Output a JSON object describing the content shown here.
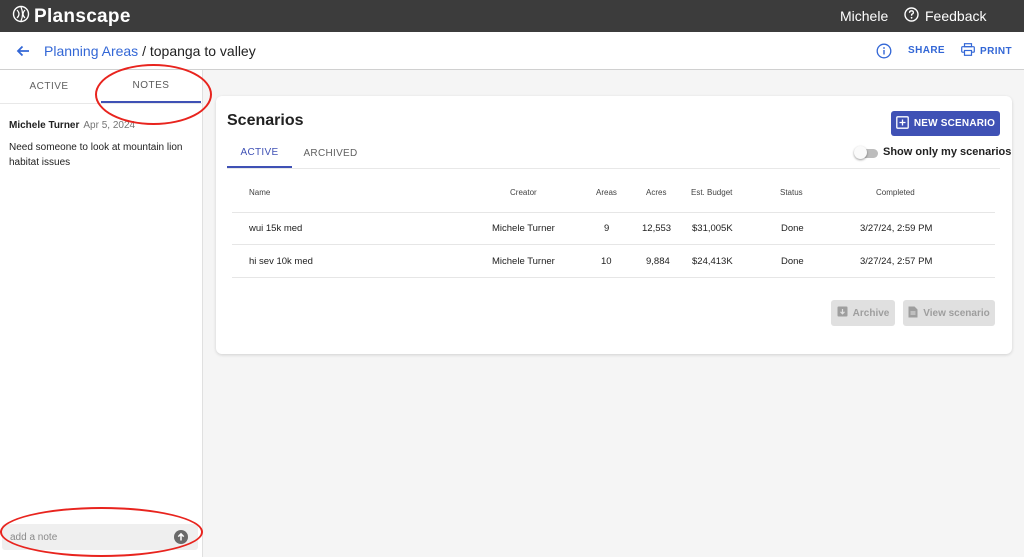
{
  "app": {
    "brand": "Planscape",
    "user": "Michele",
    "feedback_label": "Feedback"
  },
  "header": {
    "breadcrumb_link": "Planning Areas",
    "breadcrumb_sep": " / ",
    "breadcrumb_current": "topanga to valley",
    "share_label": "SHARE",
    "print_label": "PRINT"
  },
  "sidebar": {
    "tabs": [
      {
        "label": "ACTIVE"
      },
      {
        "label": "NOTES"
      }
    ],
    "selected_tab": "NOTES",
    "notes": [
      {
        "author": "Michele Turner",
        "date": "Apr 5, 2024",
        "text": "Need someone to look at mountain lion habitat issues"
      }
    ],
    "note_input": {
      "placeholder": "add a note",
      "value": ""
    }
  },
  "scenarios": {
    "title": "Scenarios",
    "new_button": "NEW SCENARIO",
    "tabs": [
      {
        "label": "ACTIVE"
      },
      {
        "label": "ARCHIVED"
      }
    ],
    "selected_tab": "ACTIVE",
    "toggle_label": "Show only my scenarios",
    "toggle_on": false,
    "columns": [
      "Name",
      "Creator",
      "Areas",
      "Acres",
      "Est. Budget",
      "Status",
      "Completed"
    ],
    "rows": [
      {
        "name": "wui 15k med",
        "creator": "Michele Turner",
        "areas": "9",
        "acres": "12,553",
        "budget": "$31,005K",
        "status": "Done",
        "completed": "3/27/24, 2:59 PM"
      },
      {
        "name": "hi sev 10k med",
        "creator": "Michele Turner",
        "areas": "10",
        "acres": "9,884",
        "budget": "$24,413K",
        "status": "Done",
        "completed": "3/27/24, 2:57 PM"
      }
    ],
    "archive_button": "Archive",
    "view_button": "View scenario"
  },
  "colors": {
    "accent": "#3f51b5",
    "link": "#3367d6",
    "topbar": "#3c3c3c",
    "annotation": "#e8241e"
  }
}
